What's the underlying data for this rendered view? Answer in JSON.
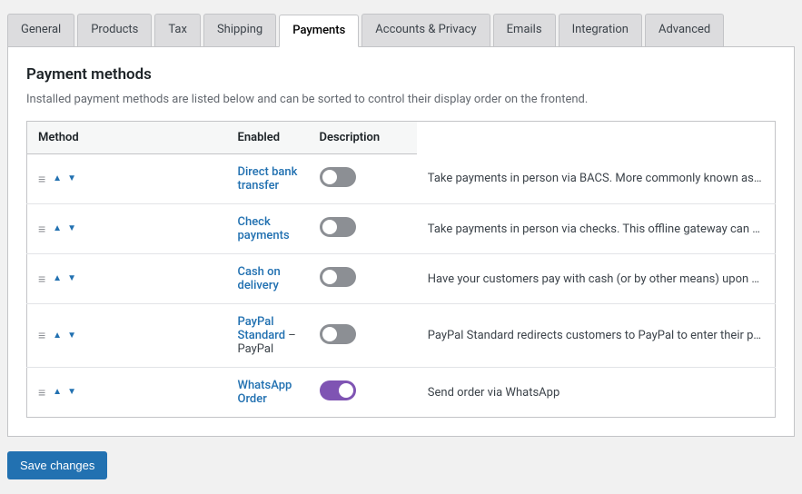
{
  "tabs": [
    {
      "id": "general",
      "label": "General",
      "active": false
    },
    {
      "id": "products",
      "label": "Products",
      "active": false
    },
    {
      "id": "tax",
      "label": "Tax",
      "active": false
    },
    {
      "id": "shipping",
      "label": "Shipping",
      "active": false
    },
    {
      "id": "payments",
      "label": "Payments",
      "active": true
    },
    {
      "id": "accounts-privacy",
      "label": "Accounts & Privacy",
      "active": false
    },
    {
      "id": "emails",
      "label": "Emails",
      "active": false
    },
    {
      "id": "integration",
      "label": "Integration",
      "active": false
    },
    {
      "id": "advanced",
      "label": "Advanced",
      "active": false
    }
  ],
  "page": {
    "section_title": "Payment methods",
    "section_desc": "Installed payment methods are listed below and can be sorted to control their display order on the frontend."
  },
  "table": {
    "headers": {
      "method": "Method",
      "enabled": "Enabled",
      "description": "Description"
    },
    "rows": [
      {
        "id": "bacs",
        "method_label": "Direct bank transfer",
        "method_extra": "",
        "enabled": false,
        "description": "Take payments in person via BACS. More commonly known as direct bank/wire tran"
      },
      {
        "id": "cheque",
        "method_label": "Check payments",
        "method_extra": "",
        "enabled": false,
        "description": "Take payments in person via checks. This offline gateway can also be useful to test"
      },
      {
        "id": "cod",
        "method_label": "Cash on delivery",
        "method_extra": "",
        "enabled": false,
        "description": "Have your customers pay with cash (or by other means) upon delivery."
      },
      {
        "id": "paypal",
        "method_label": "PayPal Standard",
        "method_extra": " – PayPal",
        "enabled": false,
        "description": "PayPal Standard redirects customers to PayPal to enter their payment information."
      },
      {
        "id": "whatsapp",
        "method_label": "WhatsApp Order",
        "method_extra": "",
        "enabled": true,
        "description": "Send order via WhatsApp"
      }
    ]
  },
  "buttons": {
    "save": "Save changes"
  }
}
